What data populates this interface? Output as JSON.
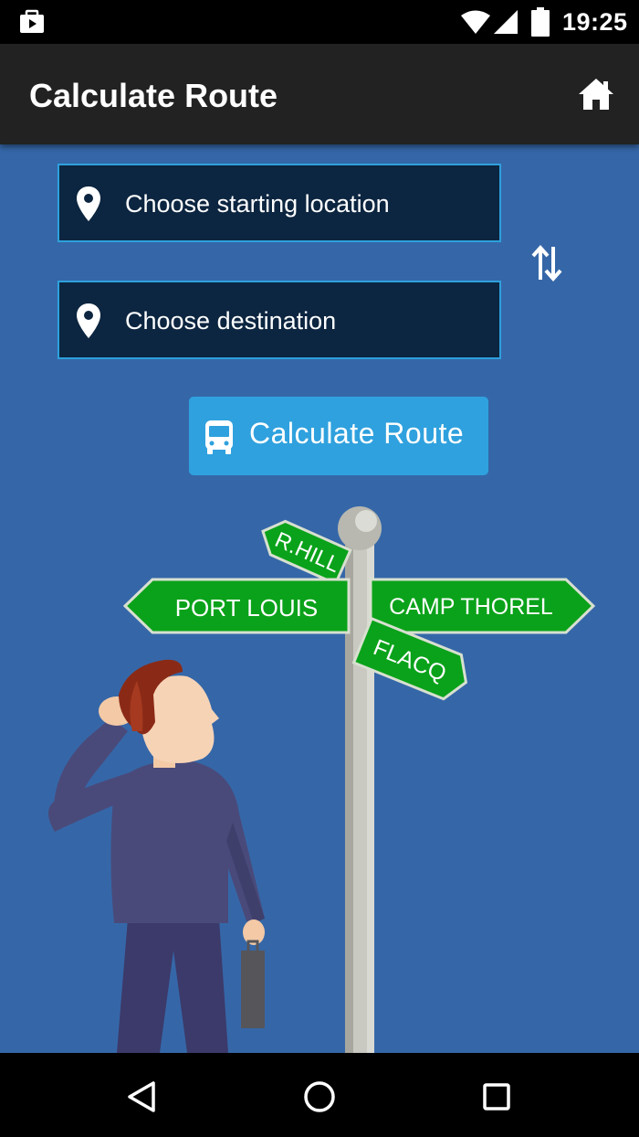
{
  "status_bar": {
    "time": "19:25",
    "icons": [
      "notification-icon",
      "wifi-icon",
      "cellular-icon",
      "battery-icon"
    ]
  },
  "app_bar": {
    "title": "Calculate Route",
    "home_icon": "home-icon"
  },
  "form": {
    "start_placeholder": "Choose starting location",
    "destination_placeholder": "Choose destination",
    "swap_icon": "swap-vertical-icon",
    "calculate_label": "Calculate Route",
    "calculate_icon": "bus-icon"
  },
  "signpost": {
    "signs": [
      "R.HILL",
      "PORT LOUIS",
      "CAMP THOREL",
      "FLACQ"
    ]
  },
  "nav_bar": {
    "buttons": [
      "back-icon",
      "home-circle-icon",
      "recents-icon"
    ]
  },
  "colors": {
    "background": "#3567a8",
    "app_bar": "#222222",
    "field_bg": "#0c2540",
    "field_border": "#2ea0dc",
    "button": "#2fa1de",
    "sign_green": "#0aa21a"
  }
}
